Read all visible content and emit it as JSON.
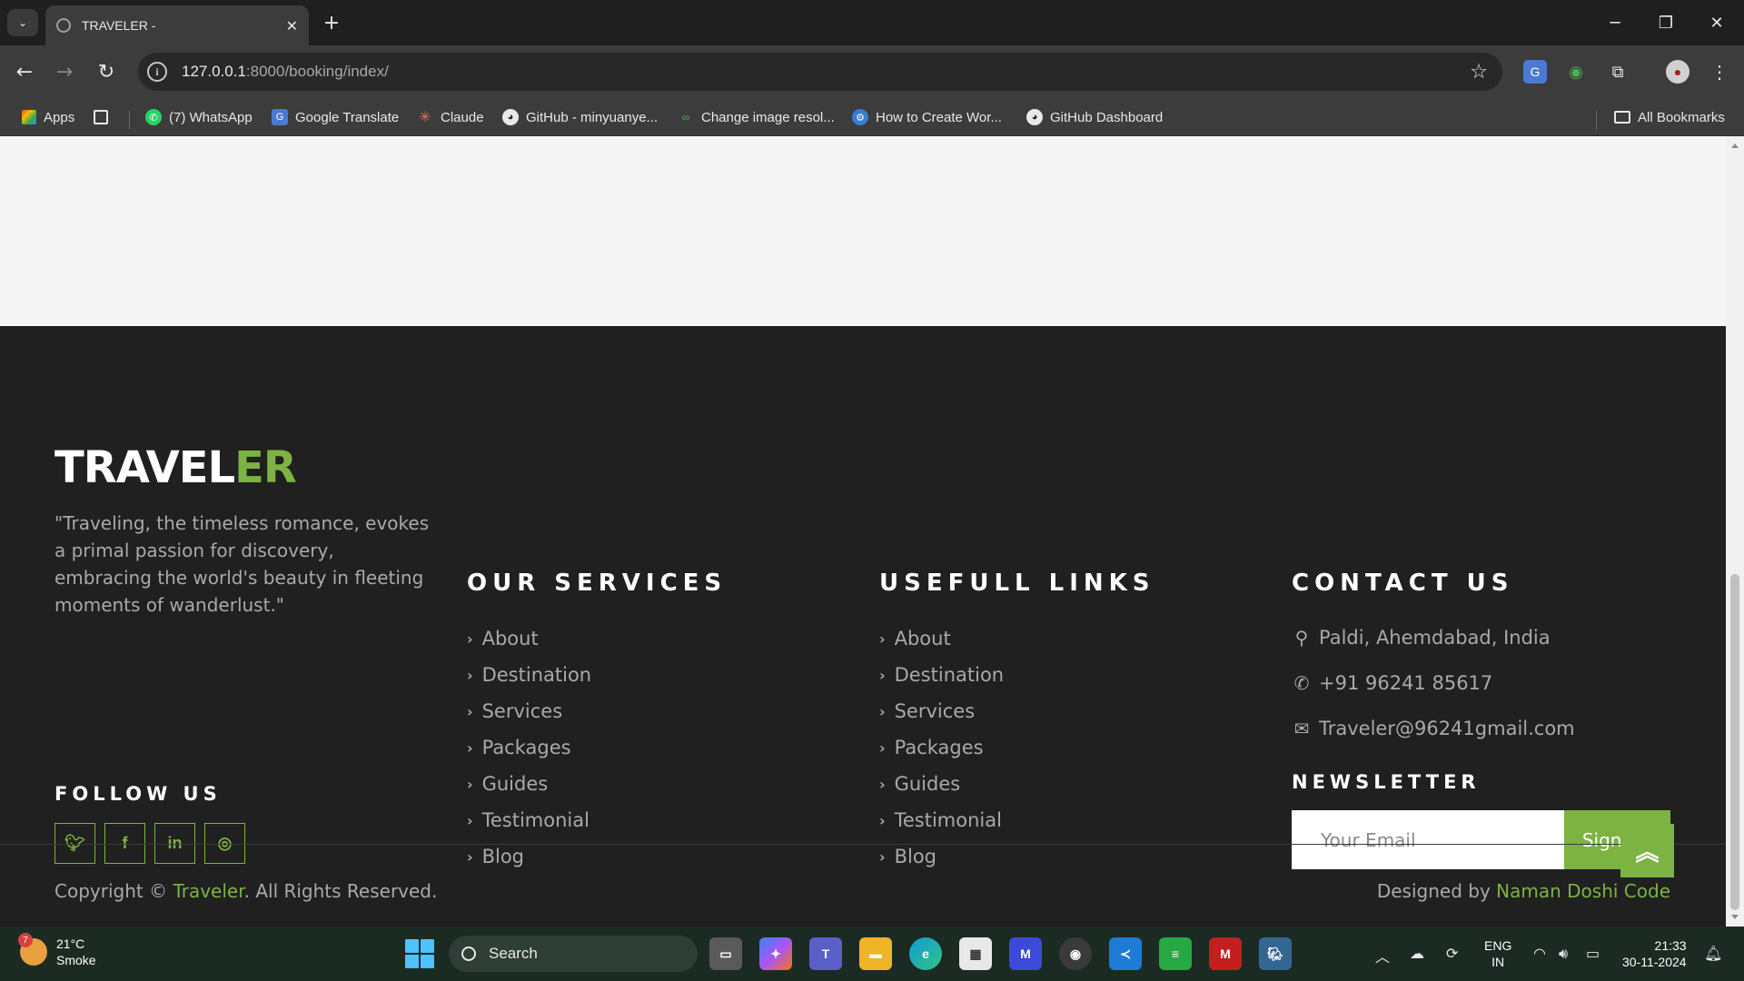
{
  "browser": {
    "tab_title": "TRAVELER -",
    "url_host": "127.0.0.1",
    "url_rest": ":8000/booking/index/",
    "bookmarks": [
      "Apps",
      "(7) WhatsApp",
      "Google Translate",
      "Claude",
      "GitHub - minyuanye...",
      "Change image resol...",
      "How to Create Wor...",
      "GitHub Dashboard"
    ],
    "all_bookmarks": "All Bookmarks"
  },
  "footer": {
    "brand_main": "TRAVEL",
    "brand_accent": "ER",
    "about": "\"Traveling, the timeless romance, evokes a primal passion for discovery, embracing the world's beauty in fleeting moments of wanderlust.\"",
    "follow_heading": "FOLLOW US",
    "social_icons": [
      "twitter-icon",
      "facebook-icon",
      "linkedin-icon",
      "instagram-icon"
    ],
    "services_heading": "OUR SERVICES",
    "services": [
      "About",
      "Destination",
      "Services",
      "Packages",
      "Guides",
      "Testimonial",
      "Blog"
    ],
    "links_heading": "USEFULL LINKS",
    "links": [
      "About",
      "Destination",
      "Services",
      "Packages",
      "Guides",
      "Testimonial",
      "Blog"
    ],
    "contact_heading": "CONTACT US",
    "address": "Paldi, Ahemdabad, India",
    "phone": "+91 96241 85617",
    "email": "Traveler@96241gmail.com",
    "newsletter_heading": "NEWSLETTER",
    "email_placeholder": "Your Email",
    "signup_label": "Sign Up",
    "copyright_prefix": "Copyright ©",
    "copyright_brand": "Traveler",
    "copyright_suffix": ". All Rights Reserved.",
    "designed_prefix": "Designed by",
    "designer": "Naman Doshi Code"
  },
  "taskbar": {
    "weather_badge": "7",
    "temperature": "21°C",
    "condition": "Smoke",
    "search_label": "Search",
    "lang_top": "ENG",
    "lang_bottom": "IN",
    "time": "21:33",
    "date": "30-11-2024"
  },
  "colors": {
    "accent": "#7cb342",
    "footer_bg": "#202020",
    "page_bg": "#f5f5f5"
  }
}
